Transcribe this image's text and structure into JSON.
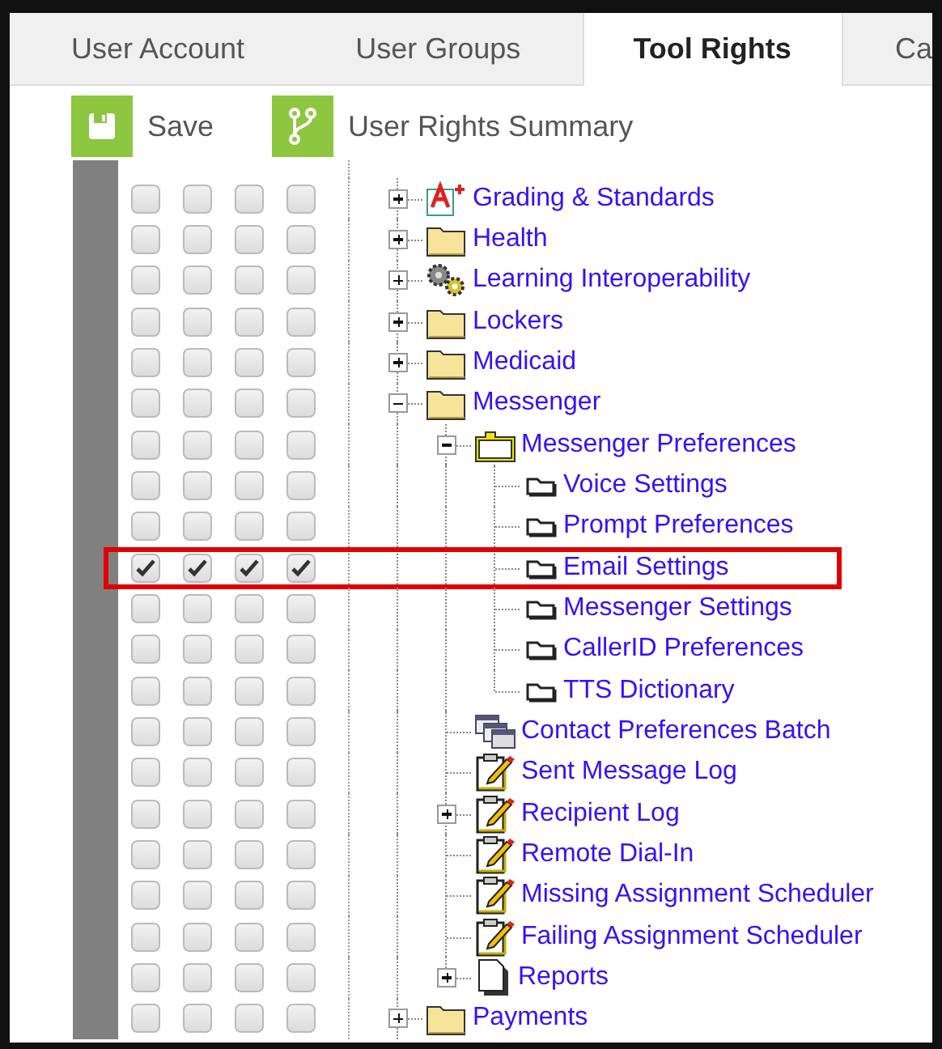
{
  "tabs": [
    {
      "label": "User Account",
      "selected": false
    },
    {
      "label": "User Groups",
      "selected": false
    },
    {
      "label": "Tool Rights",
      "selected": true
    },
    {
      "label": "Ca",
      "selected": false
    }
  ],
  "toolbar": [
    {
      "label": "Save",
      "kind": "save"
    },
    {
      "label": "User Rights Summary",
      "kind": "summary"
    }
  ],
  "tree": [
    {
      "label": "Grading & Standards",
      "kind": "grading",
      "expanded": false,
      "highlighted": false,
      "rights": [
        false,
        false,
        false,
        false
      ]
    },
    {
      "label": "Health",
      "kind": "folder",
      "expanded": false,
      "highlighted": false,
      "rights": [
        false,
        false,
        false,
        false
      ]
    },
    {
      "label": "Learning Interoperability",
      "kind": "gears",
      "expanded": false,
      "highlighted": false,
      "rights": [
        false,
        false,
        false,
        false
      ]
    },
    {
      "label": "Lockers",
      "kind": "folder",
      "expanded": false,
      "highlighted": false,
      "rights": [
        false,
        false,
        false,
        false
      ]
    },
    {
      "label": "Medicaid",
      "kind": "folder",
      "expanded": false,
      "highlighted": false,
      "rights": [
        false,
        false,
        false,
        false
      ]
    },
    {
      "label": "Messenger",
      "kind": "folder",
      "expanded": true,
      "highlighted": false,
      "rights": [
        false,
        false,
        false,
        false
      ],
      "children": [
        {
          "label": "Messenger Preferences",
          "kind": "open-folder",
          "expanded": true,
          "highlighted": false,
          "rights": [
            false,
            false,
            false,
            false
          ],
          "children": [
            {
              "label": "Voice Settings",
              "kind": "page",
              "highlighted": false,
              "rights": [
                false,
                false,
                false,
                false
              ]
            },
            {
              "label": "Prompt Preferences",
              "kind": "page",
              "highlighted": false,
              "rights": [
                false,
                false,
                false,
                false
              ]
            },
            {
              "label": "Email Settings",
              "kind": "page",
              "highlighted": true,
              "rights": [
                true,
                true,
                true,
                true
              ]
            },
            {
              "label": "Messenger Settings",
              "kind": "page",
              "highlighted": false,
              "rights": [
                false,
                false,
                false,
                false
              ]
            },
            {
              "label": "CallerID Preferences",
              "kind": "page",
              "highlighted": false,
              "rights": [
                false,
                false,
                false,
                false
              ]
            },
            {
              "label": "TTS Dictionary",
              "kind": "page",
              "highlighted": false,
              "rights": [
                false,
                false,
                false,
                false
              ]
            }
          ]
        },
        {
          "label": "Contact Preferences Batch",
          "kind": "windows",
          "highlighted": false,
          "rights": [
            false,
            false,
            false,
            false
          ]
        },
        {
          "label": "Sent Message Log",
          "kind": "clipboard",
          "highlighted": false,
          "rights": [
            false,
            false,
            false,
            false
          ]
        },
        {
          "label": "Recipient Log",
          "kind": "clipboard",
          "expanded": false,
          "highlighted": false,
          "rights": [
            false,
            false,
            false,
            false
          ]
        },
        {
          "label": "Remote Dial-In",
          "kind": "clipboard",
          "highlighted": false,
          "rights": [
            false,
            false,
            false,
            false
          ]
        },
        {
          "label": "Missing Assignment Scheduler",
          "kind": "clipboard",
          "highlighted": false,
          "rights": [
            false,
            false,
            false,
            false
          ]
        },
        {
          "label": "Failing Assignment Scheduler",
          "kind": "clipboard",
          "highlighted": false,
          "rights": [
            false,
            false,
            false,
            false
          ]
        },
        {
          "label": "Reports",
          "kind": "document",
          "expanded": false,
          "highlighted": false,
          "rights": [
            false,
            false,
            false,
            false
          ]
        }
      ]
    },
    {
      "label": "Payments",
      "kind": "folder",
      "expanded": false,
      "highlighted": false,
      "rights": [
        false,
        false,
        false,
        false
      ]
    }
  ]
}
